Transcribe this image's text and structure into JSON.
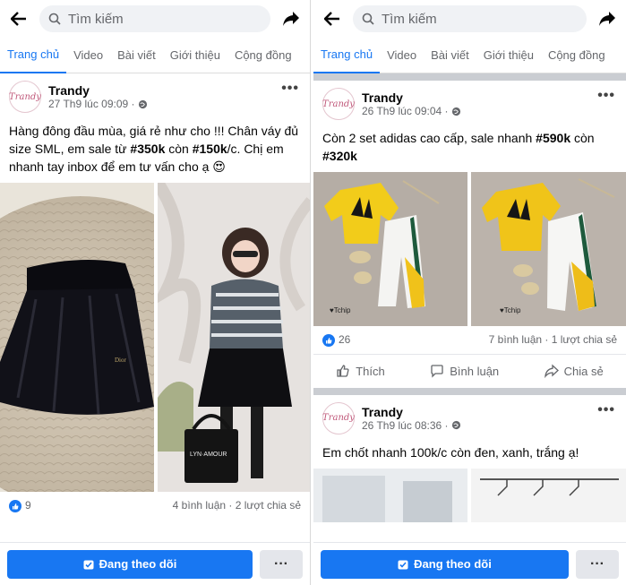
{
  "colors": {
    "accent": "#1877f2",
    "bg_gray": "#f0f2f5"
  },
  "left": {
    "search_placeholder": "Tìm kiếm",
    "tabs": [
      "Trang chủ",
      "Video",
      "Bài viết",
      "Giới thiệu",
      "Cộng đồng"
    ],
    "post": {
      "author": "Trandy",
      "avatar_text": "Trandy",
      "time": "27 Th9 lúc 09:09 ·",
      "caption_1": "Hàng đông đầu mùa, giá rẻ như cho !!! Chân váy đủ size SML, em sale từ ",
      "price_old": "#350k",
      "caption_2": " còn ",
      "price_new": "#150k",
      "caption_3": "/c. Chị em nhanh tay inbox để em tư vấn cho ạ 😍",
      "likes": "9",
      "comments_shares": "4 bình luận · 2 lượt chia sẻ"
    },
    "follow_label": "Đang theo dõi",
    "more_label": "···"
  },
  "right": {
    "search_placeholder": "Tìm kiếm",
    "tabs": [
      "Trang chủ",
      "Video",
      "Bài viết",
      "Giới thiệu",
      "Cộng đồng"
    ],
    "post1": {
      "author": "Trandy",
      "avatar_text": "Trandy",
      "time": "26 Th9 lúc 09:04 ·",
      "caption_1": "Còn 2 set adidas cao cấp, sale nhanh ",
      "price_old": "#590k",
      "caption_2": " còn ",
      "price_new": "#320k",
      "likes": "26",
      "comments_shares": "7 bình luận · 1 lượt chia sẻ",
      "like_label": "Thích",
      "comment_label": "Bình luận",
      "share_label": "Chia sẻ"
    },
    "post2": {
      "author": "Trandy",
      "avatar_text": "Trandy",
      "time": "26 Th9 lúc 08:36 ·",
      "caption": "Em chốt nhanh 100k/c còn đen, xanh, trắng ạ!"
    },
    "follow_label": "Đang theo dõi",
    "more_label": "···"
  },
  "post_more": "•••"
}
